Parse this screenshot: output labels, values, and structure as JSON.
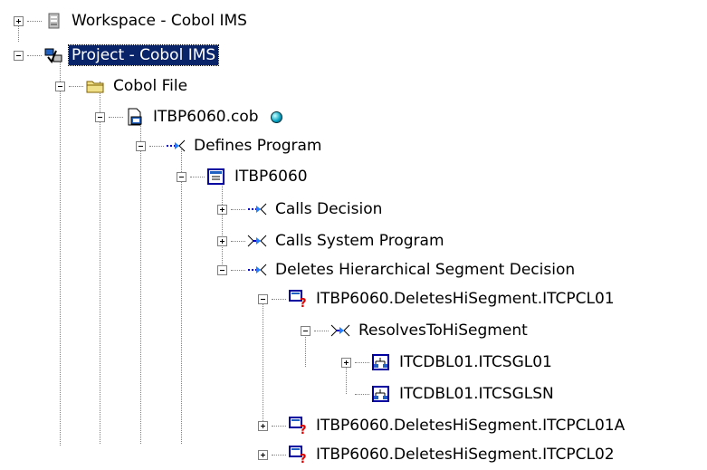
{
  "tree": {
    "workspace": "Workspace - Cobol IMS",
    "project": "Project - Cobol IMS",
    "cobol_file": "Cobol File",
    "file": "ITBP6060.cob",
    "defines_program": "Defines Program",
    "program": "ITBP6060",
    "calls_decision": "Calls Decision",
    "calls_system_program": "Calls System Program",
    "deletes_segment_decision": "Deletes Hierarchical Segment Decision",
    "decision_1": "ITBP6060.DeletesHiSegment.ITCPCL01",
    "resolves_to": "ResolvesToHiSegment",
    "segment_1": "ITCDBL01.ITCSGL01",
    "segment_2": "ITCDBL01.ITCSGLSN",
    "decision_2": "ITBP6060.DeletesHiSegment.ITCPCL01A",
    "decision_3": "ITBP6060.DeletesHiSegment.ITCPCL02"
  },
  "icons": {
    "workspace": "workspace-icon",
    "project": "project-icon",
    "folder": "folder-icon",
    "file": "cobol-file-icon",
    "relationship": "relationship-icon",
    "program": "program-icon",
    "decision": "decision-icon",
    "segment": "segment-icon",
    "status_bullet": "status-bullet-icon"
  },
  "colors": {
    "selection": "#0a246a",
    "accent": "#0000c0"
  }
}
